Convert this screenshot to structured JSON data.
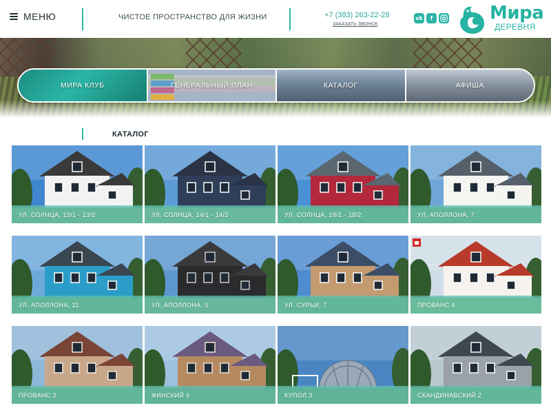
{
  "header": {
    "menu_label": "МЕНЮ",
    "tagline": "ЧИСТОЕ ПРОСТРАНСТВО ДЛЯ ЖИЗНИ",
    "phone": "+7 (383) 263-22-28",
    "callback": "ЗАКАЗАТЬ ЗВОНОК",
    "socials": [
      "vk",
      "f",
      "ig"
    ],
    "logo_word": "Мира",
    "logo_sub": "ДЕРЕВНЯ"
  },
  "tabs": [
    {
      "label": "МИРА КЛУБ"
    },
    {
      "label": "ГЕНЕРАЛЬНЫЙ ПЛАН"
    },
    {
      "label": "КАТАЛОГ"
    },
    {
      "label": "АФИША"
    }
  ],
  "catalog": {
    "title": "КАТАЛОГ",
    "items": [
      {
        "label": "УЛ. СОЛНЦА, 13/1 - 13/2",
        "style": "white",
        "sky": "#3f86cf"
      },
      {
        "label": "УЛ. СОЛНЦА, 14/1 - 14/2",
        "style": "navy",
        "sky": "#5d9bd6"
      },
      {
        "label": "УЛ. СОЛНЦА, 18/1 - 18/2",
        "style": "red",
        "sky": "#4a90d4"
      },
      {
        "label": "УЛ. АПОЛЛОНА, 7",
        "style": "whitewide",
        "sky": "#6fa6d8"
      },
      {
        "label": "УЛ. АПОЛЛОНА, 11",
        "style": "blue",
        "sky": "#6ea9dc"
      },
      {
        "label": "УЛ. АПОЛЛОНА, 5",
        "style": "dark",
        "sky": "#5d97cf"
      },
      {
        "label": "УЛ. СУРЬИ, 7",
        "style": "wood",
        "sky": "#4f8ccf"
      },
      {
        "label": "ПРОВАНС 4",
        "style": "provence",
        "sky": "#cfdde6"
      },
      {
        "label": "ПРОВАНС 2",
        "style": "brick",
        "sky": "#8fb7d8"
      },
      {
        "label": "ФИНСКИЙ 6",
        "style": "finnish",
        "sky": "#9ec1de"
      },
      {
        "label": "КУПОЛ 3",
        "style": "dome",
        "sky": "#4b86c4"
      },
      {
        "label": "СКАНДИНАВСКИЙ 2",
        "style": "scandi",
        "sky": "#b9c7cf"
      }
    ]
  },
  "colors": {
    "accent": "#2bb5a6",
    "text": "#1d2a30"
  }
}
